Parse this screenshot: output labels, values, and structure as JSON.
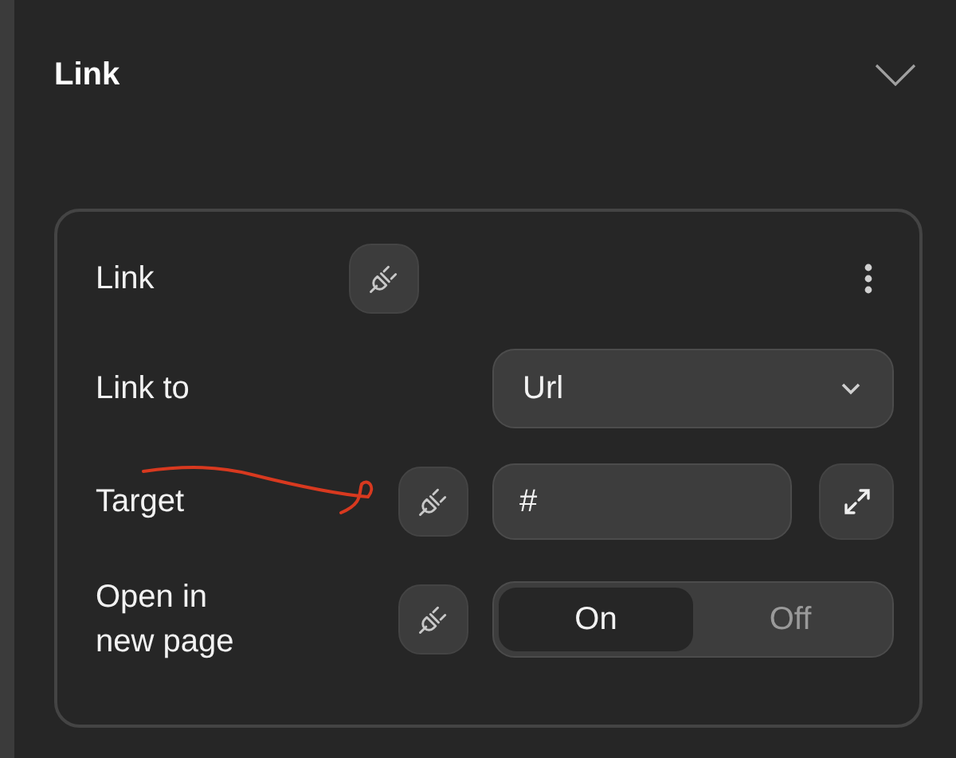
{
  "section": {
    "title": "Link",
    "expanded": true
  },
  "rows": [
    {
      "kind": "header",
      "label": "Link"
    },
    {
      "kind": "select",
      "label": "Link to",
      "value": "Url"
    },
    {
      "kind": "input",
      "label": "Target",
      "value": "#"
    },
    {
      "kind": "toggle",
      "label": "Open in new page",
      "options": [
        {
          "label": "On",
          "selected": true
        },
        {
          "label": "Off",
          "selected": false
        }
      ]
    }
  ]
}
